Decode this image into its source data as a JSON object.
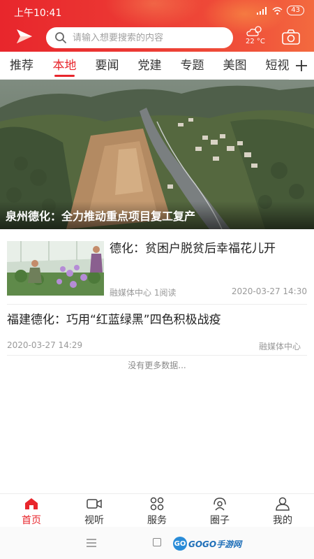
{
  "status_bar": {
    "time": "上午10:41",
    "battery": "43",
    "colors": {
      "header_start": "#e8262c",
      "header_end": "#f36a3f"
    }
  },
  "header": {
    "logo_icon": "app-logo-icon",
    "search_placeholder": "请输入想要搜索的内容",
    "weather_icon": "partly-cloudy-icon",
    "weather_temp": "22 °C",
    "camera_icon": "camera-icon"
  },
  "tabs": {
    "items": [
      {
        "label": "推荐",
        "active": false
      },
      {
        "label": "本地",
        "active": true
      },
      {
        "label": "要闻",
        "active": false
      },
      {
        "label": "党建",
        "active": false
      },
      {
        "label": "专题",
        "active": false
      },
      {
        "label": "美图",
        "active": false
      },
      {
        "label": "短视",
        "active": false
      }
    ],
    "add_icon": "plus-icon",
    "accent_color": "#e8262c"
  },
  "hero": {
    "caption": "泉州德化：全力推动重点项目复工复产"
  },
  "articles": [
    {
      "title": "德化：贫困户脱贫后幸福花儿开",
      "source": "融媒体中心",
      "reads": "1阅读",
      "date": "2020-03-27 14:30"
    },
    {
      "title": "福建德化：巧用“红蓝绿黑”四色积极战疫",
      "date": "2020-03-27 14:29",
      "source": "融媒体中心"
    }
  ],
  "list_end_text": "没有更多数据...",
  "bottom_nav": [
    {
      "label": "首页",
      "icon": "home-icon",
      "active": true
    },
    {
      "label": "视听",
      "icon": "video-icon",
      "active": false
    },
    {
      "label": "服务",
      "icon": "grid-icon",
      "active": false
    },
    {
      "label": "圈子",
      "icon": "community-icon",
      "active": false
    },
    {
      "label": "我的",
      "icon": "person-icon",
      "active": false
    }
  ],
  "watermark": {
    "logo_text": "GO",
    "text": "GOGO手游网"
  }
}
